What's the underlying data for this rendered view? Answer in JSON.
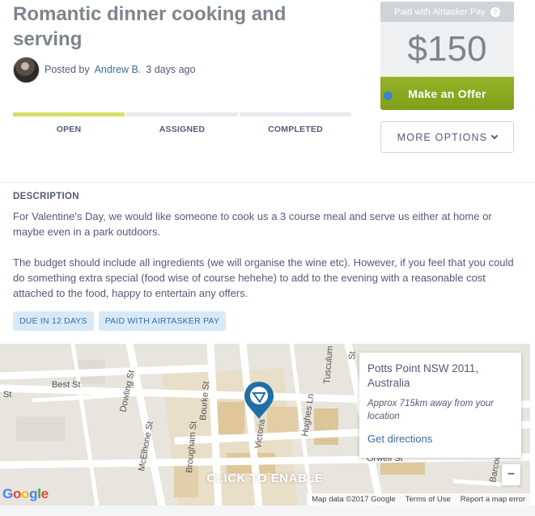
{
  "task": {
    "title": "Romantic dinner cooking and serving",
    "posted_prefix": "Posted by",
    "poster_name": "Andrew B.",
    "posted_ago": "3 days ago"
  },
  "progress": {
    "steps": [
      {
        "label": "OPEN",
        "active": true
      },
      {
        "label": "ASSIGNED",
        "active": false
      },
      {
        "label": "COMPLETED",
        "active": false
      }
    ]
  },
  "payment": {
    "header": "Paid with Airtasker Pay",
    "help_icon": "?",
    "price": "$150",
    "offer_label": "Make an Offer",
    "more_options_label": "MORE OPTIONS"
  },
  "description": {
    "heading": "DESCRIPTION",
    "paragraphs": [
      "For Valentine's Day, we would like someone to cook us a 3 course meal and serve us either at home or maybe even in a park outdoors.",
      "The budget should include all ingredients (we will organise the wine etc). However, if you feel that you could do something extra special (food wise of course hehehe) to add to the evening with a reasonable cost attached to the food, happy to entertain any offers."
    ],
    "tags": [
      "DUE IN 12 DAYS",
      "PAID WITH AIRTASKER PAY"
    ]
  },
  "map": {
    "streets": [
      "Best St",
      "Dowling St",
      "Bourke St",
      "Brougham St",
      "McElhone St",
      "Victoria",
      "Hughes Ln",
      "Tusculum",
      "Orwell St",
      "Barcoda St",
      "St"
    ],
    "enable_label": "CLICK TO ENABLE",
    "google_letters": [
      "G",
      "o",
      "o",
      "g",
      "l",
      "e"
    ],
    "footer": [
      "Map data ©2017 Google",
      "Terms of Use",
      "Report a map error"
    ],
    "zoom_out": "−",
    "popup": {
      "location": "Potts Point NSW 2011, Australia",
      "distance": "Approx 715km away from your location",
      "directions": "Get directions"
    }
  },
  "colors": {
    "title": "#7e858c",
    "accent_green": "#8aab22",
    "link_blue": "#3b6e9c",
    "progress_active": "#d5e06b",
    "pin_blue": "#1f6fa6"
  }
}
